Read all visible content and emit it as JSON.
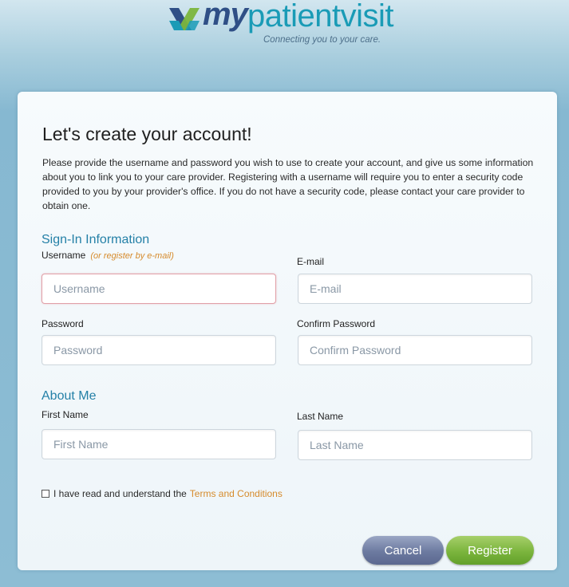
{
  "brand": {
    "name_prefix": "my",
    "name_rest": "patientvisit",
    "tagline": "Connecting you to your care.",
    "logo_icon": "mypatientvisit-logo-mark",
    "colors": {
      "navy": "#2f4f86",
      "teal": "#1a9bb6",
      "green": "#7bb53d"
    }
  },
  "form": {
    "title": "Let's create your account!",
    "intro": "Please provide the username and password you wish to use to create your account, and give us some information about you to link you to your care provider. Registering with a username will require you to enter a security code provided to you by your provider's office. If you do not have a security code, please contact your care provider to obtain one.",
    "signin_section": "Sign-In Information",
    "username_label": "Username",
    "username_hint": "(or register by e-mail)",
    "username_placeholder": "Username",
    "email_label": "E-mail",
    "email_placeholder": "E-mail",
    "password_label": "Password",
    "password_placeholder": "Password",
    "confirm_label": "Confirm Password",
    "confirm_placeholder": "Confirm Password",
    "about_section": "About Me",
    "firstname_label": "First Name",
    "firstname_placeholder": "First Name",
    "lastname_label": "Last Name",
    "lastname_placeholder": "Last Name",
    "terms_text": "I have read and understand the",
    "terms_link": "Terms and Conditions",
    "cancel_label": "Cancel",
    "register_label": "Register",
    "accent_color": "#2480a7",
    "link_color": "#d68b2c"
  }
}
